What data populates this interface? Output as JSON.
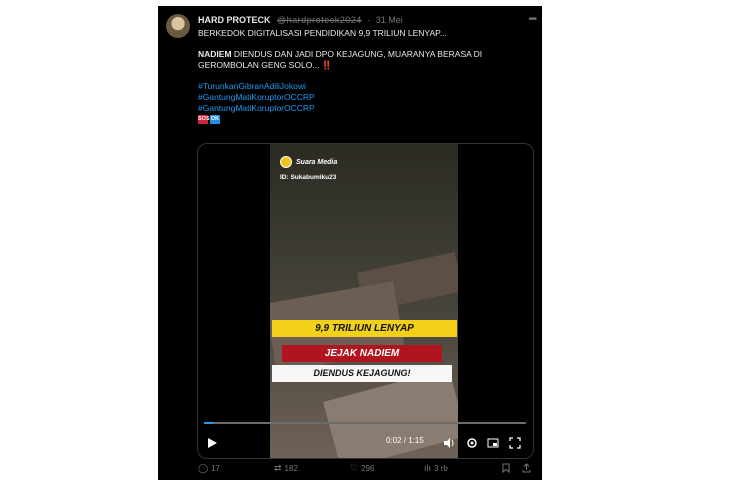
{
  "tweet": {
    "author_name": "HARD PROTECK",
    "handle": "@hardproteck2024",
    "separator": "·",
    "date": "31 Mei",
    "line1": "BERKEDOK DIGITALISASI PENDIDIKAN 9,9 TRILIUN LENYAP...",
    "line2_bold": "NADIEM",
    "line2_rest": " DIENDUS DAN JADI DPO KEJAGUNG, MUARANYA BERASA DI GEROMBOLAN GENG SOLO... ",
    "line2_mark": "‼️",
    "hashtags": [
      "#TurunkanGibranAdiliJokowi",
      "#GantungMatiKoruptorOCCRP",
      "#GantungMatiKoruptorOCCRP"
    ],
    "emoji": [
      "SOS",
      "OK"
    ]
  },
  "video": {
    "logo_text": "Suara Media",
    "id_text": "ID: Sukabumiku23",
    "banner1": "9,9 TRILIUN LENYAP",
    "banner2": "JEJAK NADIEM",
    "banner3": "DIENDUS KEJAGUNG!",
    "time": "0:02 / 1:15",
    "progress_fraction": 0.027
  },
  "actions": {
    "replies": "17",
    "reposts": "182",
    "likes": "296",
    "views": "3 rb"
  },
  "colors": {
    "background": "#000000",
    "text": "#e7e9ea",
    "muted": "#71767b",
    "link": "#1d9bf0"
  }
}
